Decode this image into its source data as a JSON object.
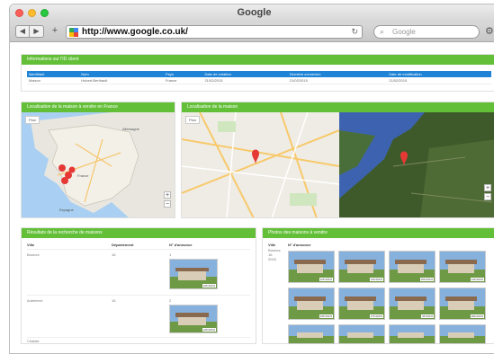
{
  "window": {
    "title": "Google"
  },
  "toolbar": {
    "url": "http://www.google.co.uk/",
    "search_placeholder": "Google",
    "back": "◀",
    "forward": "▶",
    "add": "+"
  },
  "info_panel": {
    "header": "Informations sur l'ID client",
    "columns": [
      "Identifiant",
      "Nom",
      "Pays",
      "Date de création",
      "Dernière connexion",
      "Date de modification"
    ],
    "row": [
      "Maison",
      "Hubert.Berthault",
      "France",
      "21/02/2015",
      "21/02/2015",
      "21/02/2015"
    ]
  },
  "map_france": {
    "header": "Localisation de la maison à vendre en France",
    "labels": {
      "country": "France",
      "north": "Allemagne",
      "south": "Espagne"
    },
    "badge": "Plan"
  },
  "map_detail": {
    "header": "Localisation de la maison",
    "badge": "Plan"
  },
  "listing_table": {
    "header": "Résultats de la recherche de maisons",
    "columns": [
      "Ville",
      "Département",
      "N° d'annonce"
    ],
    "rows": [
      {
        "city": "Bonnes",
        "dept": "16",
        "ref": "1",
        "price": "135 000 €"
      },
      {
        "city": "Aubeterre",
        "dept": "16",
        "ref": "2",
        "price": "145 000 €"
      },
      {
        "city": "Chalais",
        "dept": "16",
        "ref": "3",
        "price": ""
      }
    ]
  },
  "gallery": {
    "header": "Photos des maisons à vendre",
    "columns": [
      "Ville",
      "N° d'annonce"
    ],
    "city": "Bonnes",
    "dept": "16",
    "year": "2015",
    "prices": [
      "125 000 €",
      "135 000 €",
      "155 000 €",
      "145 000 €",
      "165 000 €",
      "175 000 €",
      "95 000 €",
      "189 000 €"
    ]
  }
}
